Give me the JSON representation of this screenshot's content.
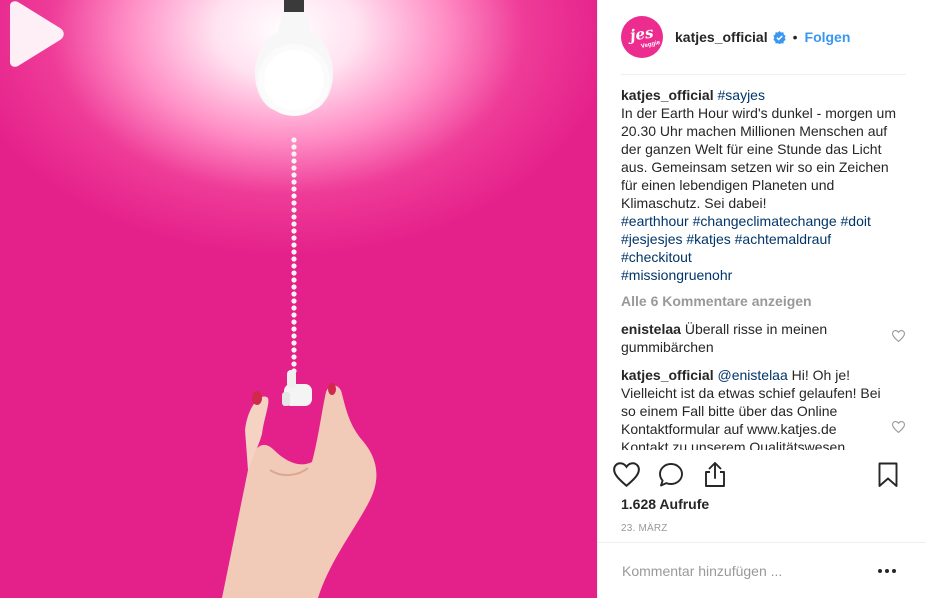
{
  "post": {
    "username": "katjes_official",
    "verified": true,
    "separator": "•",
    "follow_label": "Folgen",
    "avatar": {
      "text": "jes",
      "subtext": "Veggie",
      "color": "#ec2c8e"
    }
  },
  "caption": {
    "username": "katjes_official",
    "lead_tag": "#sayjes",
    "text": "In der Earth Hour wird's dunkel - morgen um 20.30 Uhr machen Millionen Menschen auf der ganzen Welt für eine Stunde das Licht aus. Gemeinsam setzen wir so ein Zeichen für einen lebendigen Planeten und Klimaschutz. Sei dabei!",
    "hashtags": [
      "#earthhour",
      "#changeclimatechange",
      "#doit",
      "#jesjesjes",
      "#katjes",
      "#achtemaldrauf",
      "#checkitout",
      "#missiongruenohr"
    ]
  },
  "view_all_label": "Alle 6 Kommentare anzeigen",
  "comments": [
    {
      "username": "enistelaa",
      "mention": "",
      "text": "Überall risse in meinen gummibärchen"
    },
    {
      "username": "katjes_official",
      "mention": "@enistelaa",
      "text": "Hi! Oh je! Vielleicht ist da etwas schief gelaufen! Bei so einem Fall bitte über das Online Kontaktformular auf www.katjes.de Kontakt zu unserem Qualitätswesen"
    }
  ],
  "stats": {
    "views": "1.628 Aufrufe",
    "date": "23. MÄRZ"
  },
  "add_comment": {
    "placeholder": "Kommentar hinzufügen ...",
    "more_label": "..."
  },
  "icons": {
    "like": "heart-outline-icon",
    "comment": "comment-bubble-icon",
    "share": "share-icon",
    "save": "bookmark-icon",
    "play": "play-icon",
    "verified": "verified-badge-icon"
  },
  "colors": {
    "accent": "#3897f0",
    "hashtag": "#003569",
    "muted": "#999999",
    "media_background": "#e4208a"
  }
}
